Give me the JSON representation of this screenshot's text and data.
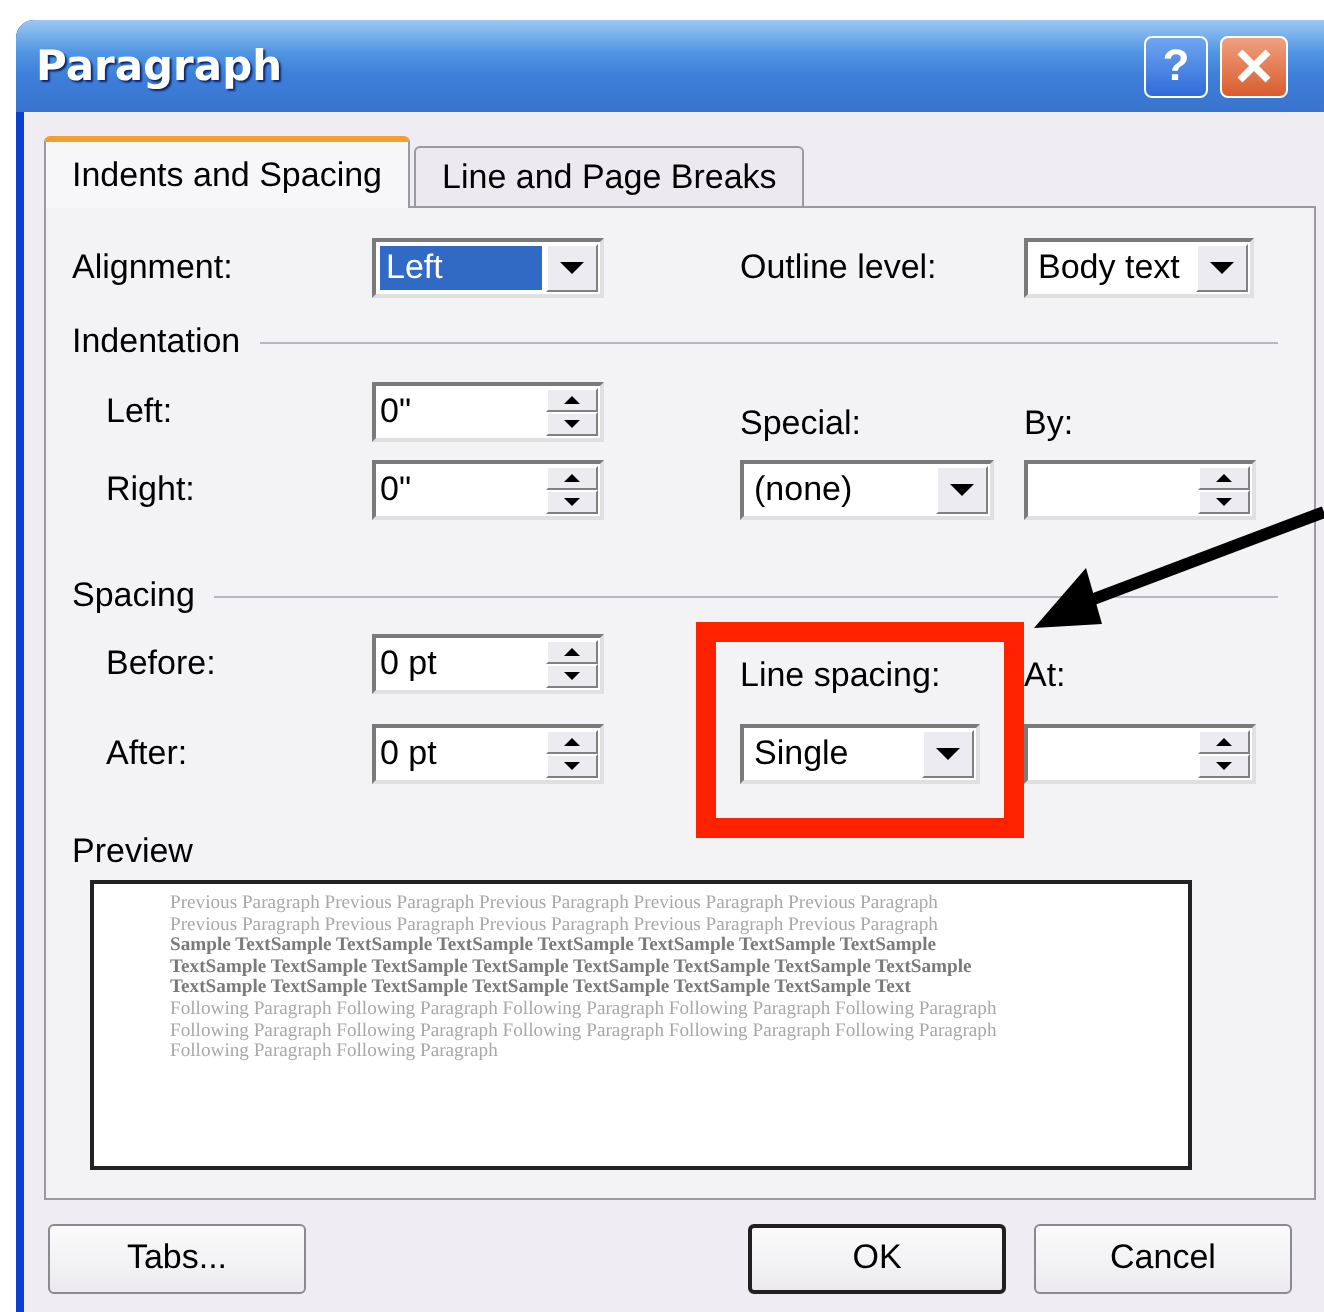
{
  "window": {
    "title": "Paragraph",
    "help_button": "?"
  },
  "tabs": [
    {
      "label": "Indents and Spacing",
      "selected": true
    },
    {
      "label": "Line and Page Breaks",
      "selected": false
    }
  ],
  "general": {
    "alignment": {
      "label": "Alignment:",
      "value": "Left",
      "focused": true
    },
    "outline_level": {
      "label": "Outline level:",
      "value": "Body text",
      "focused": false
    }
  },
  "indentation": {
    "title": "Indentation",
    "left": {
      "label": "Left:",
      "value": "0\""
    },
    "right": {
      "label": "Right:",
      "value": "0\""
    },
    "special": {
      "label": "Special:",
      "value": "(none)",
      "focused": false
    },
    "by": {
      "label": "By:"
    }
  },
  "spacing": {
    "title": "Spacing",
    "before": {
      "label": "Before:",
      "value": "0 pt"
    },
    "after": {
      "label": "After:",
      "value": "0 pt"
    },
    "line_spacing": {
      "label": "Line spacing:",
      "value": "Single",
      "focused": false,
      "highlighted": true
    },
    "at": {
      "label": "At:"
    }
  },
  "preview": {
    "title": "Preview",
    "previous_lines": [
      "Previous Paragraph Previous Paragraph Previous Paragraph Previous Paragraph Previous Paragraph",
      "Previous Paragraph Previous Paragraph Previous Paragraph Previous Paragraph Previous Paragraph"
    ],
    "sample_lines": [
      "Sample TextSample TextSample TextSample TextSample TextSample TextSample TextSample",
      "TextSample TextSample TextSample TextSample TextSample TextSample TextSample TextSample",
      "TextSample TextSample TextSample TextSample TextSample TextSample TextSample Text"
    ],
    "following_lines": [
      "Following Paragraph Following Paragraph Following Paragraph Following Paragraph Following Paragraph",
      "Following Paragraph Following Paragraph Following Paragraph Following Paragraph Following Paragraph",
      "Following Paragraph Following Paragraph"
    ]
  },
  "buttons": [
    {
      "label": "Tabs...",
      "default": false
    },
    {
      "label": "OK",
      "default": true
    },
    {
      "label": "Cancel",
      "default": false
    }
  ]
}
